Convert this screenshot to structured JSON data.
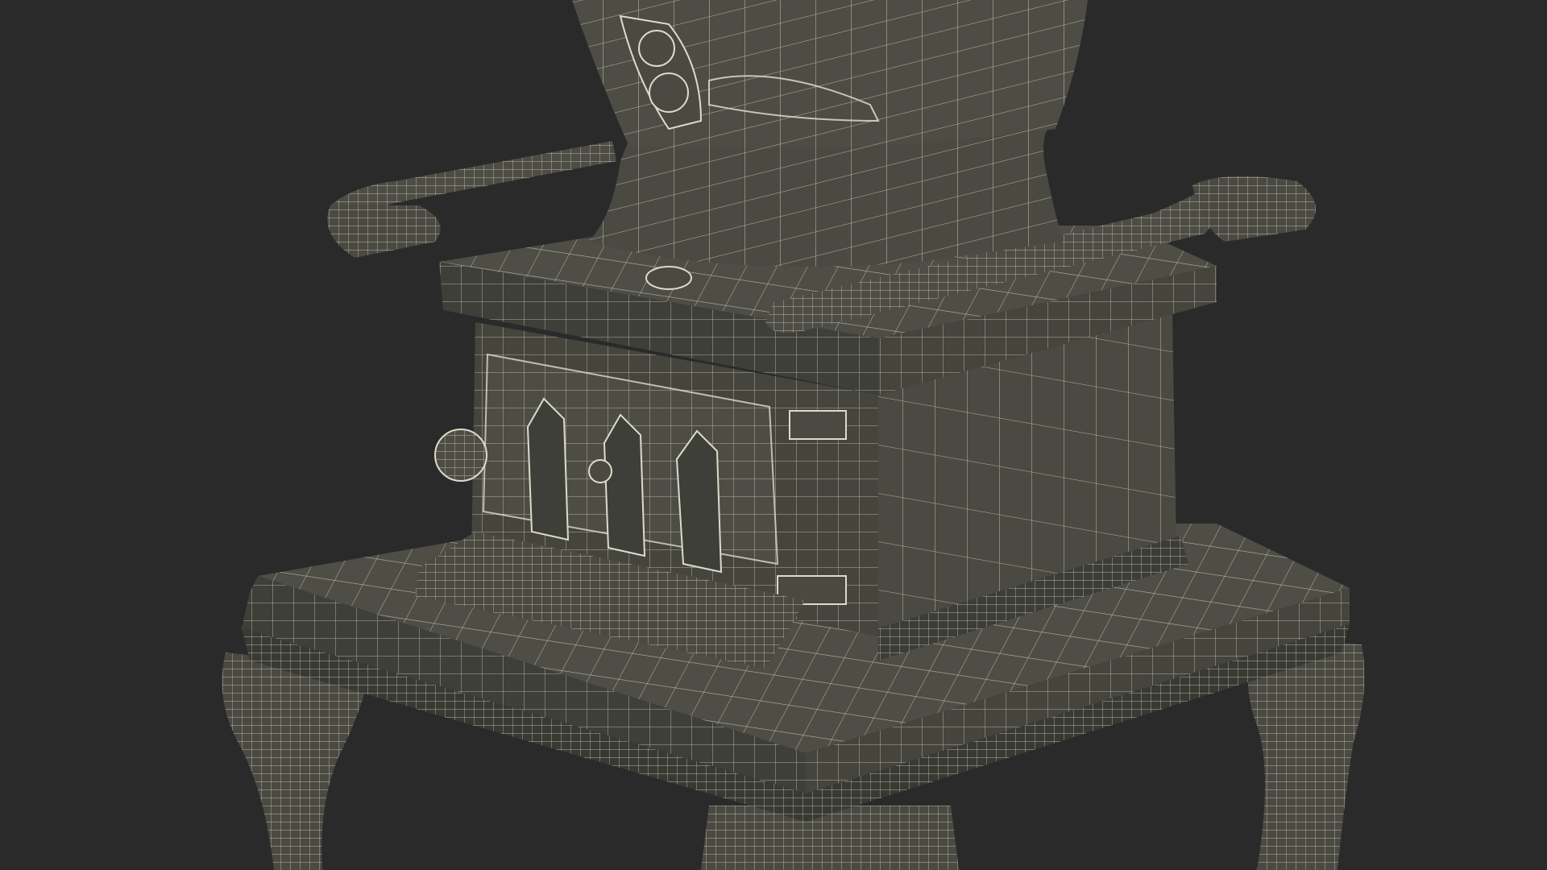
{
  "scene": {
    "subject": "wood-stove-wireframe-render",
    "colors": {
      "background": "#2a2a2a",
      "surface": "#4a4a43",
      "surface_dark": "#3a3a34",
      "surface_light": "#58584f",
      "wire": "#dcdccb",
      "edge": "#9c9c8a"
    }
  }
}
